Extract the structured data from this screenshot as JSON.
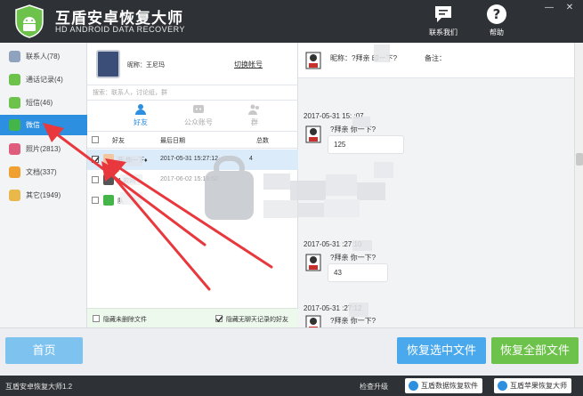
{
  "app": {
    "title": "互盾安卓恢复大师",
    "subtitle": "HD ANDROID DATA RECOVERY",
    "contact_label": "联系我们",
    "help_label": "帮助",
    "minimize_glyph": "—",
    "close_glyph": "✕"
  },
  "sidebar": {
    "items": [
      {
        "label": "联系人(78)",
        "icon": "contacts-icon",
        "color": "#8fa3bf"
      },
      {
        "label": "通话记录(4)",
        "icon": "phone-icon",
        "color": "#6cc24a"
      },
      {
        "label": "短信(46)",
        "icon": "sms-icon",
        "color": "#6cc24a"
      },
      {
        "label": "微信",
        "icon": "wechat-icon",
        "color": "#44b549"
      },
      {
        "label": "照片(2813)",
        "icon": "photo-icon",
        "color": "#e05c7d"
      },
      {
        "label": "文档(337)",
        "icon": "document-icon",
        "color": "#f0a030"
      },
      {
        "label": "其它(1949)",
        "icon": "other-icon",
        "color": "#e8b84a"
      }
    ]
  },
  "wechat_panel": {
    "nickname_label": "昵称：",
    "nickname_value": "王尼玛",
    "switch_account": "切换帐号",
    "search_placeholder": "搜索：联系人，讨论组，群",
    "tabs": [
      {
        "label": "好友",
        "icon": "friend-icon"
      },
      {
        "label": "公众账号",
        "icon": "official-account-icon"
      },
      {
        "label": "群",
        "icon": "group-icon"
      }
    ],
    "columns": {
      "friend": "好友",
      "last_date": "最后日期",
      "total": "总数"
    },
    "rows": [
      {
        "name": "开   你一下♦",
        "date": "2017-05-31 15:27:12",
        "total": "4",
        "checked": true
      },
      {
        "name": "A   款网",
        "date": "2017-06-02 15:19:52",
        "total": "",
        "checked": false
      },
      {
        "name": "    队",
        "date": "",
        "total": "",
        "checked": false
      }
    ],
    "hide_deleted": "隐藏未删除文件",
    "hide_no_chat": "隐藏无聊天记录的好友"
  },
  "chat": {
    "header_nick_label": "昵称：",
    "header_nick_value": "?拜亲  印一下?",
    "header_note_label": "备注：",
    "messages": [
      {
        "time": "2017-05-31 15:  :07",
        "sender": "?拜亲   你一下?",
        "text": "125"
      },
      {
        "time": "2017-05-31   :27:10",
        "sender": "?拜亲   你一下?",
        "text": "43"
      },
      {
        "time": "2017-05-31   :27:12",
        "sender": "?拜亲   你一下?",
        "text": ""
      }
    ]
  },
  "actions": {
    "home": "首页",
    "recover_selected": "恢复选中文件",
    "recover_all": "恢复全部文件"
  },
  "status": {
    "version": "互盾安卓恢复大师1.2",
    "check_update": "检查升级",
    "product1": "互盾数据恢复软件",
    "product2": "互盾苹果恢复大师"
  },
  "colors": {
    "titlebar": "#2e3135",
    "accent_blue": "#2d8fe0",
    "accent_green": "#6cc24a",
    "arrow_red": "#e8383d"
  }
}
